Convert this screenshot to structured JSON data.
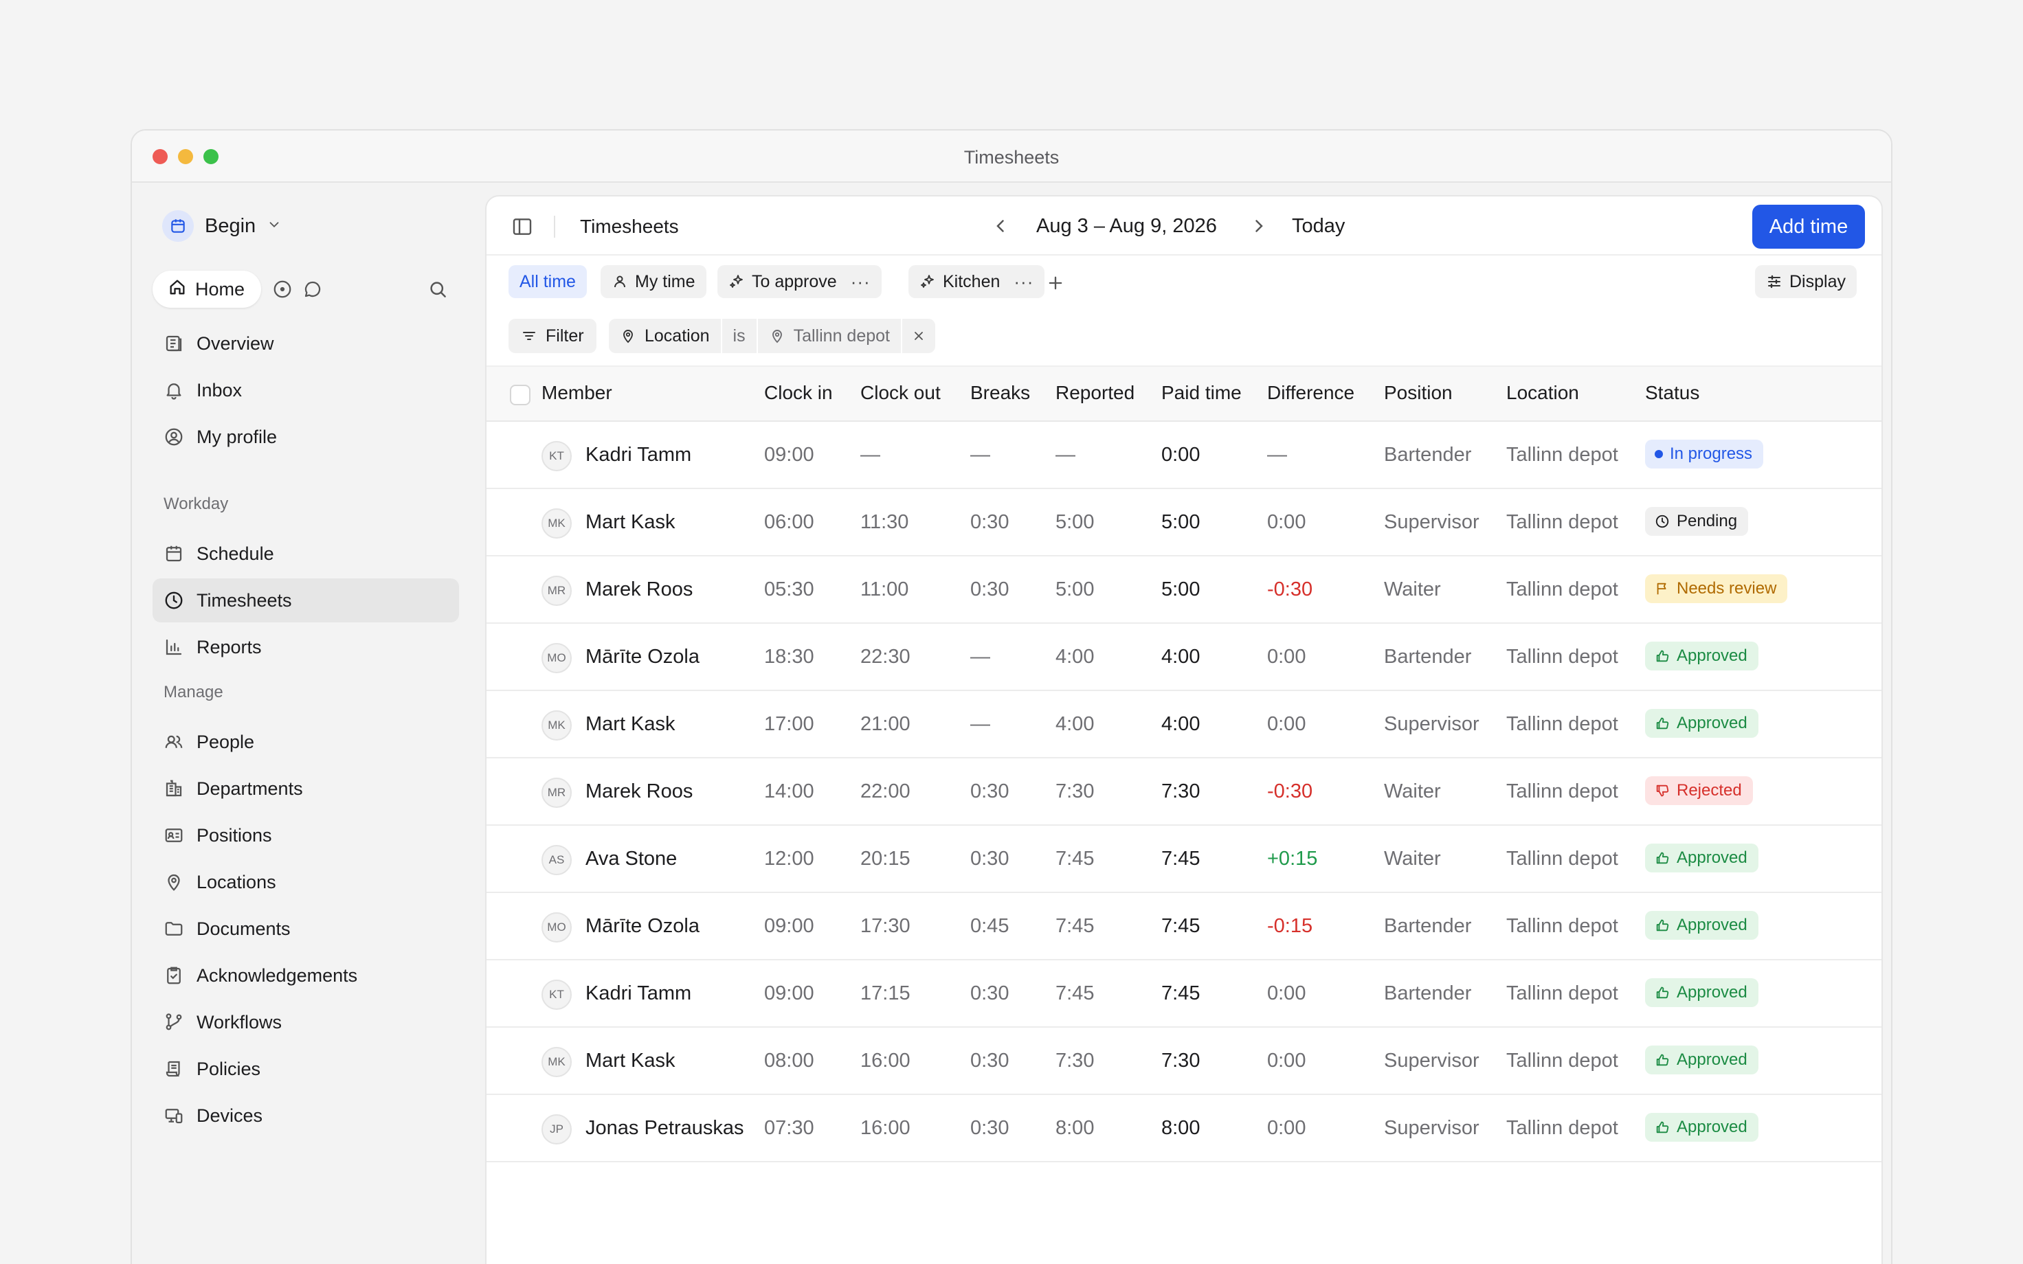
{
  "window": {
    "title": "Timesheets"
  },
  "sidebar": {
    "workspace": "Begin",
    "home_label": "Home",
    "top_items": [
      {
        "label": "Overview",
        "icon": "overview-icon"
      },
      {
        "label": "Inbox",
        "icon": "bell-icon"
      },
      {
        "label": "My profile",
        "icon": "profile-icon"
      }
    ],
    "workday_heading": "Workday",
    "workday_items": [
      {
        "label": "Schedule",
        "icon": "calendar-icon"
      },
      {
        "label": "Timesheets",
        "icon": "clock-icon",
        "active": true
      },
      {
        "label": "Reports",
        "icon": "chart-icon"
      }
    ],
    "manage_heading": "Manage",
    "manage_items": [
      {
        "label": "People",
        "icon": "people-icon"
      },
      {
        "label": "Departments",
        "icon": "building-icon"
      },
      {
        "label": "Positions",
        "icon": "id-card-icon"
      },
      {
        "label": "Locations",
        "icon": "map-pin-icon"
      },
      {
        "label": "Documents",
        "icon": "folder-icon"
      },
      {
        "label": "Acknowledgements",
        "icon": "clipboard-check-icon"
      },
      {
        "label": "Workflows",
        "icon": "workflow-icon"
      },
      {
        "label": "Policies",
        "icon": "scroll-icon"
      },
      {
        "label": "Devices",
        "icon": "devices-icon"
      }
    ]
  },
  "topbar": {
    "title": "Timesheets",
    "date_range": "Aug 3 – Aug 9, 2026",
    "today_label": "Today",
    "add_label": "Add time"
  },
  "views": {
    "all_time": "All time",
    "my_time": "My time",
    "to_approve": "To approve",
    "kitchen": "Kitchen",
    "display": "Display"
  },
  "filter": {
    "button": "Filter",
    "field": "Location",
    "operator": "is",
    "value": "Tallinn depot"
  },
  "table": {
    "headers": {
      "member": "Member",
      "clock_in": "Clock in",
      "clock_out": "Clock out",
      "breaks": "Breaks",
      "reported": "Reported",
      "paid": "Paid time",
      "difference": "Difference",
      "position": "Position",
      "location": "Location",
      "status": "Status"
    },
    "rows": [
      {
        "initials": "KT",
        "name": "Kadri Tamm",
        "clock_in": "09:00",
        "clock_out": "—",
        "breaks": "—",
        "reported": "—",
        "paid": "0:00",
        "difference": "—",
        "diff_tone": "neutral",
        "position": "Bartender",
        "location": "Tallinn depot",
        "status": "In progress",
        "status_kind": "progress"
      },
      {
        "initials": "MK",
        "name": "Mart Kask",
        "clock_in": "06:00",
        "clock_out": "11:30",
        "breaks": "0:30",
        "reported": "5:00",
        "paid": "5:00",
        "difference": "0:00",
        "diff_tone": "neutral",
        "position": "Supervisor",
        "location": "Tallinn depot",
        "status": "Pending",
        "status_kind": "pending"
      },
      {
        "initials": "MR",
        "name": "Marek Roos",
        "clock_in": "05:30",
        "clock_out": "11:00",
        "breaks": "0:30",
        "reported": "5:00",
        "paid": "5:00",
        "difference": "-0:30",
        "diff_tone": "neg",
        "position": "Waiter",
        "location": "Tallinn depot",
        "status": "Needs review",
        "status_kind": "review"
      },
      {
        "initials": "MO",
        "name": "Mārīte Ozola",
        "clock_in": "18:30",
        "clock_out": "22:30",
        "breaks": "—",
        "reported": "4:00",
        "paid": "4:00",
        "difference": "0:00",
        "diff_tone": "neutral",
        "position": "Bartender",
        "location": "Tallinn depot",
        "status": "Approved",
        "status_kind": "approved"
      },
      {
        "initials": "MK",
        "name": "Mart Kask",
        "clock_in": "17:00",
        "clock_out": "21:00",
        "breaks": "—",
        "reported": "4:00",
        "paid": "4:00",
        "difference": "0:00",
        "diff_tone": "neutral",
        "position": "Supervisor",
        "location": "Tallinn depot",
        "status": "Approved",
        "status_kind": "approved"
      },
      {
        "initials": "MR",
        "name": "Marek Roos",
        "clock_in": "14:00",
        "clock_out": "22:00",
        "breaks": "0:30",
        "reported": "7:30",
        "paid": "7:30",
        "difference": "-0:30",
        "diff_tone": "neg",
        "position": "Waiter",
        "location": "Tallinn depot",
        "status": "Rejected",
        "status_kind": "rejected"
      },
      {
        "initials": "AS",
        "name": "Ava Stone",
        "clock_in": "12:00",
        "clock_out": "20:15",
        "breaks": "0:30",
        "reported": "7:45",
        "paid": "7:45",
        "difference": "+0:15",
        "diff_tone": "pos",
        "position": "Waiter",
        "location": "Tallinn depot",
        "status": "Approved",
        "status_kind": "approved"
      },
      {
        "initials": "MO",
        "name": "Mārīte Ozola",
        "clock_in": "09:00",
        "clock_out": "17:30",
        "breaks": "0:45",
        "reported": "7:45",
        "paid": "7:45",
        "difference": "-0:15",
        "diff_tone": "neg",
        "position": "Bartender",
        "location": "Tallinn depot",
        "status": "Approved",
        "status_kind": "approved"
      },
      {
        "initials": "KT",
        "name": "Kadri Tamm",
        "clock_in": "09:00",
        "clock_out": "17:15",
        "breaks": "0:30",
        "reported": "7:45",
        "paid": "7:45",
        "difference": "0:00",
        "diff_tone": "neutral",
        "position": "Bartender",
        "location": "Tallinn depot",
        "status": "Approved",
        "status_kind": "approved"
      },
      {
        "initials": "MK",
        "name": "Mart Kask",
        "clock_in": "08:00",
        "clock_out": "16:00",
        "breaks": "0:30",
        "reported": "7:30",
        "paid": "7:30",
        "difference": "0:00",
        "diff_tone": "neutral",
        "position": "Supervisor",
        "location": "Tallinn depot",
        "status": "Approved",
        "status_kind": "approved"
      },
      {
        "initials": "JP",
        "name": "Jonas Petrauskas",
        "clock_in": "07:30",
        "clock_out": "16:00",
        "breaks": "0:30",
        "reported": "8:00",
        "paid": "8:00",
        "difference": "0:00",
        "diff_tone": "neutral",
        "position": "Supervisor",
        "location": "Tallinn depot",
        "status": "Approved",
        "status_kind": "approved"
      }
    ]
  },
  "colors": {
    "accent": "#2257e6",
    "negative": "#d6302b",
    "positive": "#1f9a4b",
    "review": "#b06a00",
    "approved": "#1b8b43"
  }
}
